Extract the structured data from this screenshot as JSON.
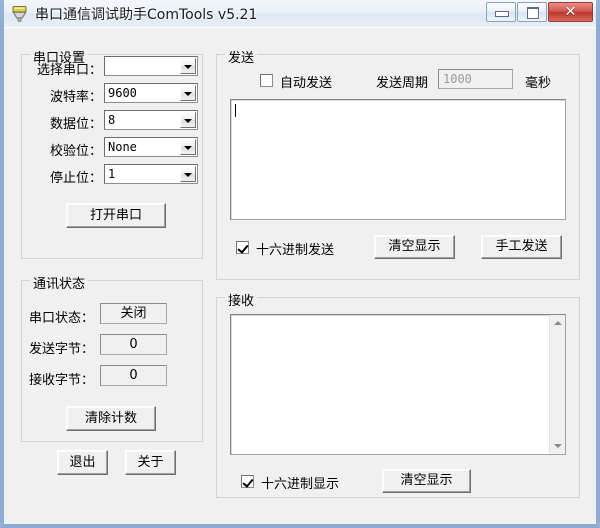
{
  "window": {
    "title": "串口通信调试助手ComTools v5.21",
    "icon": "serial-plug-icon",
    "controls": {
      "minimize": "minimize-icon",
      "maximize": "maximize-icon",
      "close": "✕"
    },
    "accent_close": "#bb3a2d",
    "frame_color": "#7ea0c8"
  },
  "serial_settings": {
    "legend": "串口设置",
    "fields": [
      {
        "label": "选择串口：",
        "value": ""
      },
      {
        "label": "波特率：",
        "value": "9600"
      },
      {
        "label": "数据位：",
        "value": "8"
      },
      {
        "label": "校验位：",
        "value": "None"
      },
      {
        "label": "停止位：",
        "value": "1"
      }
    ],
    "open_button": "打开串口"
  },
  "comm_status": {
    "legend": "通讯状态",
    "rows": [
      {
        "label": "串口状态：",
        "value": "关闭"
      },
      {
        "label": "发送字节：",
        "value": "0"
      },
      {
        "label": "接收字节：",
        "value": "0"
      }
    ],
    "clear_counter_button": "清除计数"
  },
  "bottom_buttons": {
    "exit": "退出",
    "about": "关于"
  },
  "send_panel": {
    "legend": "发送",
    "auto_send": {
      "label": "自动发送",
      "checked": false
    },
    "period_label": "发送周期",
    "period_value": "1000",
    "period_unit": "毫秒",
    "textarea_value": "",
    "hex_send": {
      "label": "十六进制发送",
      "checked": true
    },
    "clear_button": "清空显示",
    "manual_send_button": "手工发送"
  },
  "receive_panel": {
    "legend": "接收",
    "textarea_value": "",
    "hex_display": {
      "label": "十六进制显示",
      "checked": true
    },
    "clear_button": "清空显示"
  }
}
